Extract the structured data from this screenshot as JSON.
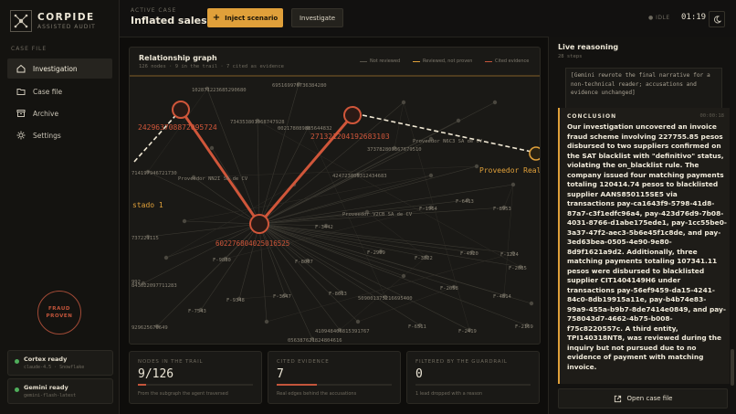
{
  "brand": {
    "name": "CORPIDE",
    "subtitle": "ASSISTED AUDIT"
  },
  "sidebar": {
    "section_label": "CASE FILE",
    "items": [
      {
        "label": "Investigation",
        "icon": "home-icon",
        "active": true
      },
      {
        "label": "Case file",
        "icon": "folder-icon",
        "active": false
      },
      {
        "label": "Archive",
        "icon": "archive-icon",
        "active": false
      },
      {
        "label": "Settings",
        "icon": "gear-icon",
        "active": false
      }
    ],
    "stamp": {
      "line1": "FRAUD",
      "line2": "PROVEN"
    },
    "status": [
      {
        "title": "Cortex ready",
        "sub": "claude-4.5 · Snowflake"
      },
      {
        "title": "Gemini ready",
        "sub": "gemini-flash-latest"
      }
    ]
  },
  "header": {
    "case_label": "ACTIVE CASE",
    "case_title": "Inflated sales",
    "inject_label": "Inject scenario",
    "investigate_label": "Investigate",
    "idle_label": "IDLE",
    "timer": "01:19"
  },
  "graph": {
    "title": "Relationship graph",
    "subtitle": "126 nodes · 9 in the trail · 7 cited as evidence",
    "legend": [
      {
        "label": "Not reviewed",
        "color": "#57534a"
      },
      {
        "label": "Reviewed, not proven",
        "color": "#e0a03a"
      },
      {
        "label": "Cited evidence",
        "color": "#c4553b"
      }
    ],
    "labels": {
      "hub": "602276804025016525",
      "left_node": "242963708872095724",
      "right_node": "271321204192683103",
      "far_right": "Proveedor Real",
      "far_left": "stado 1",
      "n1": "102871223685290680",
      "n2": "695169976736384280",
      "n3": "734353801968747928",
      "n4": "002178089885644832",
      "n5": "Proveedor N6C3 SA de CV",
      "n6": "714197946721730",
      "n7": "Proveedor NN2I SA de CV",
      "n8": "373782809367679510",
      "n9": "424723805312434683",
      "n10": "Proveedor V2CB SA de CV",
      "n11": "F-1964",
      "n12": "F-6413",
      "n13": "F-8953",
      "n14": "F-3442",
      "n15": "737221115",
      "n16": "F-9830",
      "n17": "F-8007",
      "n18": "F-2909",
      "n19": "F-3822",
      "n20": "F-4920",
      "n21": "F-1224",
      "n22": "F-2085",
      "n23": "992",
      "n24": "843622097711283",
      "n25": "F-9348",
      "n26": "F-3647",
      "n27": "F-8613",
      "n28": "509001375216695400",
      "n29": "F-2058",
      "n30": "F-4814",
      "n31": "F-7543",
      "n32": "929625670649",
      "n33": "410948406815391767",
      "n34": "F-6511",
      "n35": "F-2419",
      "n36": "F-2169",
      "n37": "056387621824804616"
    }
  },
  "stats": [
    {
      "label": "NODES IN THE TRAIL",
      "value": "9/126",
      "fraction": 0.071,
      "desc": "From the subgraph the agent traversed"
    },
    {
      "label": "CITED EVIDENCE",
      "value": "7",
      "fraction": 0.35,
      "desc": "Real edges behind the accusations"
    },
    {
      "label": "FILTERED BY THE GUARDRAIL",
      "value": "0",
      "fraction": 0,
      "desc": "1 lead dropped with a reason"
    }
  ],
  "reasoning": {
    "title": "Live reasoning",
    "subtitle": "28 steps",
    "note": "[Gemini rewrote the final narrative for a non-technical reader; accusations and evidence unchanged]",
    "conclusion_label": "CONCLUSION",
    "conclusion_time": "00:00:18",
    "conclusion": "Our investigation uncovered an invoice fraud scheme involving 227755.85 pesos disbursed to two suppliers confirmed on the SAT blacklist with \"definitivo\" status, violating the on_blacklist rule. The company issued four matching payments totaling 120414.74 pesos to blacklisted supplier AANS850115SE5 via transactions pay-ca1643f9-5798-41d8-87a7-c3f1edfc96a4, pay-423d76d9-7b08-4031-8766-d1abe175ede1, pay-1cc55be0-3a37-47f2-aec3-5b6e45f1c8de, and pay-3ed63bea-0505-4e90-9e80-8d9f1621a9d2. Additionally, three matching payments totaling 107341.11 pesos were disbursed to blacklisted supplier CIT1404149H6 under transactions pay-56ef9459-da15-4241-84c0-8db19915a11e, pay-b4b74e83-99a9-455a-b9b7-8de7414e0849, and pay-758043d7-4662-4b75-b008-f75c8220557c. A third entity, TPI140318NT8, was reviewed during the inquiry but not pursued due to no evidence of payment with matching invoice.",
    "open_label": "Open case file"
  }
}
